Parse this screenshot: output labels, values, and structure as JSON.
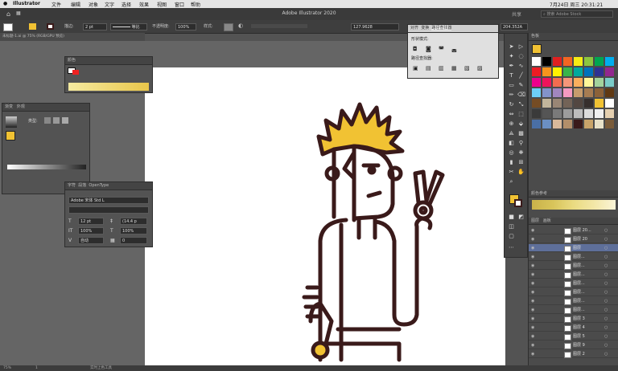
{
  "menubar": {
    "items": [
      "Illustrator",
      "文件",
      "编辑",
      "对象",
      "文字",
      "选择",
      "效果",
      "视图",
      "窗口",
      "帮助"
    ],
    "clock": "7月24日 周三 20:31:21"
  },
  "titlebar": {
    "title": "Adobe Illustrator 2020",
    "share_label": "共享",
    "search_placeholder": "搜索 Adobe Stock"
  },
  "controlbar": {
    "stroke_label": "描边:",
    "stroke_value": "2 pt",
    "stroke_profile": "等比",
    "opacity_label": "不透明度:",
    "opacity_value": "100%",
    "style_label": "样式:",
    "x_value": "127.9628",
    "y_value": "204.352A"
  },
  "doctab": {
    "label": "未标题-1.ai @ 75% (RGB/GPU 预览)"
  },
  "gradient_panel": {
    "title": "颜色"
  },
  "appearance_panel": {
    "tab1": "渐变",
    "tab2": "外观",
    "type_label": "类型:"
  },
  "char_panel": {
    "tab1": "字符",
    "tab2": "段落",
    "tab3": "OpenType",
    "font": "Adobe 宋体 Std L",
    "size": "12 pt",
    "leading": "(14.4 p",
    "vscale": "100%",
    "hscale": "100%",
    "kerning": "自动",
    "tracking": "0"
  },
  "pathfinder_panel": {
    "tab1": "对齐",
    "tab2": "变换",
    "tab3": "路径查找器",
    "shape_modes": "形状模式:",
    "pathfinders": "路径查找器:"
  },
  "swatches": {
    "title": "色板"
  },
  "layers": {
    "tab1": "图层",
    "tab2": "画板",
    "color_ref": "颜色参考",
    "rows": [
      "图层 20...",
      "图层 20",
      "图层",
      "图层...",
      "图层...",
      "图层...",
      "图层...",
      "图层...",
      "图层...",
      "图层...",
      "图层 3",
      "图层 4",
      "图层 5",
      "图层 9",
      "图层 2"
    ]
  },
  "status": {
    "zoom": "75%",
    "page": "1",
    "tool": "实时上色工具"
  },
  "colors": {
    "hair": "#f1c233",
    "stroke": "#3a1a1a",
    "selection": "#4a6fd8",
    "canvas": "#656565"
  }
}
